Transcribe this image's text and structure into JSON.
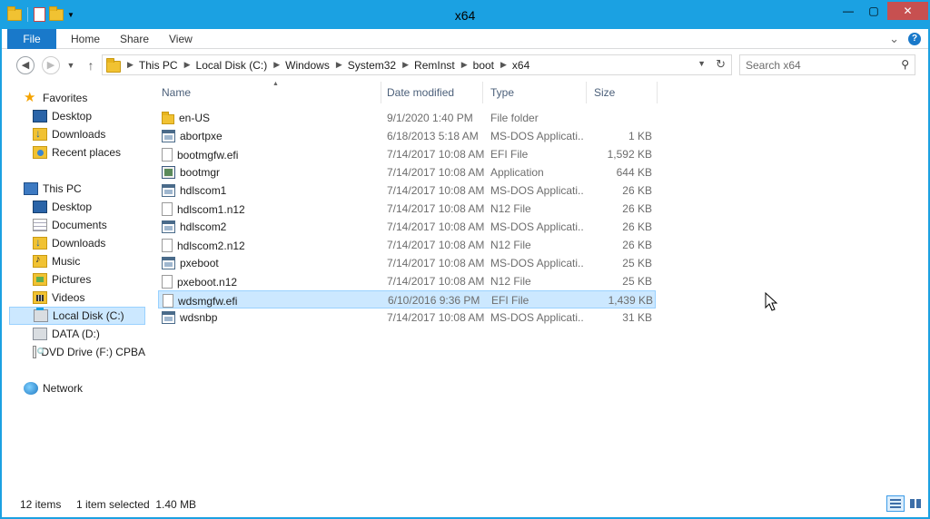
{
  "window": {
    "title": "x64",
    "controls": {
      "minimize": "—",
      "maximize": "▢",
      "close": "✕"
    }
  },
  "ribbon": {
    "tabs": [
      {
        "label": "File"
      },
      {
        "label": "Home"
      },
      {
        "label": "Share"
      },
      {
        "label": "View"
      }
    ],
    "expand_glyph": "⌄",
    "help_glyph": "?"
  },
  "address": {
    "crumbs": [
      "This PC",
      "Local Disk (C:)",
      "Windows",
      "System32",
      "RemInst",
      "boot",
      "x64"
    ]
  },
  "search": {
    "placeholder": "Search x64"
  },
  "navpane": {
    "favorites": {
      "label": "Favorites",
      "items": [
        "Desktop",
        "Downloads",
        "Recent places"
      ]
    },
    "thispc": {
      "label": "This PC",
      "items": [
        "Desktop",
        "Documents",
        "Downloads",
        "Music",
        "Pictures",
        "Videos",
        "Local Disk (C:)",
        "DATA (D:)",
        "DVD Drive (F:) CPBA"
      ]
    },
    "network": {
      "label": "Network"
    }
  },
  "columns": {
    "name": "Name",
    "date": "Date modified",
    "type": "Type",
    "size": "Size"
  },
  "files": [
    {
      "name": "en-US",
      "date": "9/1/2020 1:40 PM",
      "type": "File folder",
      "size": "",
      "icon": "folder-icon"
    },
    {
      "name": "abortpxe",
      "date": "6/18/2013 5:18 AM",
      "type": "MS-DOS Applicati...",
      "size": "1 KB",
      "icon": "app-icon"
    },
    {
      "name": "bootmgfw.efi",
      "date": "7/14/2017 10:08 AM",
      "type": "EFI File",
      "size": "1,592 KB",
      "icon": "file-icon"
    },
    {
      "name": "bootmgr",
      "date": "7/14/2017 10:08 AM",
      "type": "Application",
      "size": "644 KB",
      "icon": "exe-icon"
    },
    {
      "name": "hdlscom1",
      "date": "7/14/2017 10:08 AM",
      "type": "MS-DOS Applicati...",
      "size": "26 KB",
      "icon": "app-icon"
    },
    {
      "name": "hdlscom1.n12",
      "date": "7/14/2017 10:08 AM",
      "type": "N12 File",
      "size": "26 KB",
      "icon": "file-icon"
    },
    {
      "name": "hdlscom2",
      "date": "7/14/2017 10:08 AM",
      "type": "MS-DOS Applicati...",
      "size": "26 KB",
      "icon": "app-icon"
    },
    {
      "name": "hdlscom2.n12",
      "date": "7/14/2017 10:08 AM",
      "type": "N12 File",
      "size": "26 KB",
      "icon": "file-icon"
    },
    {
      "name": "pxeboot",
      "date": "7/14/2017 10:08 AM",
      "type": "MS-DOS Applicati...",
      "size": "25 KB",
      "icon": "app-icon"
    },
    {
      "name": "pxeboot.n12",
      "date": "7/14/2017 10:08 AM",
      "type": "N12 File",
      "size": "25 KB",
      "icon": "file-icon"
    },
    {
      "name": "wdsmgfw.efi",
      "date": "6/10/2016 9:36 PM",
      "type": "EFI File",
      "size": "1,439 KB",
      "icon": "file-icon",
      "selected": true
    },
    {
      "name": "wdsnbp",
      "date": "7/14/2017 10:08 AM",
      "type": "MS-DOS Applicati...",
      "size": "31 KB",
      "icon": "app-icon"
    }
  ],
  "status": {
    "count": "12 items",
    "selection": "1 item selected  1.40 MB"
  },
  "colors": {
    "accent": "#1ba1e2",
    "file_tab": "#1979ca",
    "selection": "#cce8ff",
    "close_button": "#c75050"
  }
}
